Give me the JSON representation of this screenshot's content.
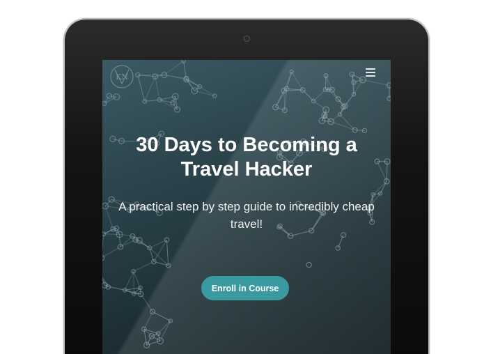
{
  "device": {
    "type": "tablet"
  },
  "header": {
    "logo_icon": "kn-monogram-logo",
    "menu_icon": "hamburger-menu-icon"
  },
  "hero": {
    "title": "30 Days to Becoming a Travel Hacker",
    "subtitle": "A practical step by step guide to incredibly cheap travel!",
    "cta_label": "Enroll in Course"
  },
  "colors": {
    "background_dark": "#1d2f35",
    "background_light": "#3c5a64",
    "accent": "#3a9aa0",
    "text": "#ffffff"
  }
}
